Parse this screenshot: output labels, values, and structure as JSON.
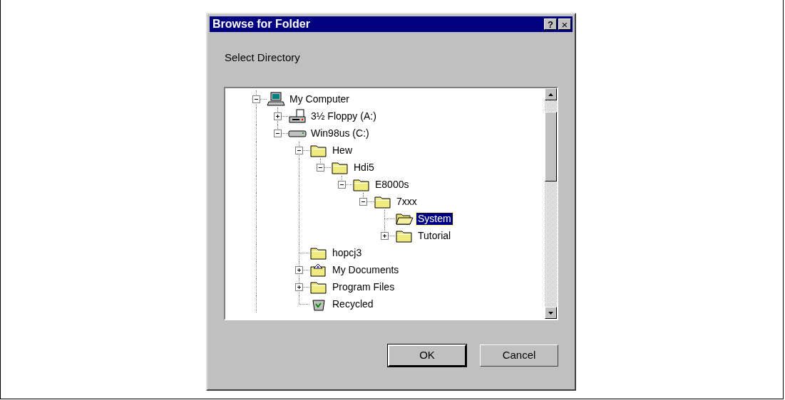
{
  "dialog": {
    "title": "Browse for Folder",
    "help_button": "?",
    "close_button": "×",
    "prompt": "Select Directory",
    "tree": [
      {
        "label": "My Computer",
        "kind": "computer",
        "expanded": true,
        "selected": false,
        "children": [
          {
            "label": "3½ Floppy (A:)",
            "kind": "floppy",
            "expanded": false,
            "selected": false
          },
          {
            "label": "Win98us (C:)",
            "kind": "drive",
            "expanded": true,
            "selected": false,
            "children": [
              {
                "label": "Hew",
                "kind": "folder",
                "expanded": true,
                "selected": false,
                "children": [
                  {
                    "label": "Hdi5",
                    "kind": "folder",
                    "expanded": true,
                    "selected": false,
                    "children": [
                      {
                        "label": "E8000s",
                        "kind": "folder",
                        "expanded": true,
                        "selected": false,
                        "children": [
                          {
                            "label": "7xxx",
                            "kind": "folder",
                            "expanded": true,
                            "selected": false,
                            "children": [
                              {
                                "label": "System",
                                "kind": "open-folder",
                                "selected": true
                              },
                              {
                                "label": "Tutorial",
                                "kind": "folder",
                                "expanded": false,
                                "selected": false
                              }
                            ]
                          }
                        ]
                      }
                    ]
                  }
                ]
              },
              {
                "label": "hopcj3",
                "kind": "folder",
                "selected": false
              },
              {
                "label": "My Documents",
                "kind": "documents",
                "expanded": false,
                "selected": false
              },
              {
                "label": "Program Files",
                "kind": "folder",
                "expanded": false,
                "selected": false
              },
              {
                "label": "Recycled",
                "kind": "recycle",
                "selected": false
              }
            ]
          }
        ]
      }
    ],
    "buttons": [
      {
        "label": "OK",
        "default": true
      },
      {
        "label": "Cancel",
        "default": false
      }
    ]
  }
}
